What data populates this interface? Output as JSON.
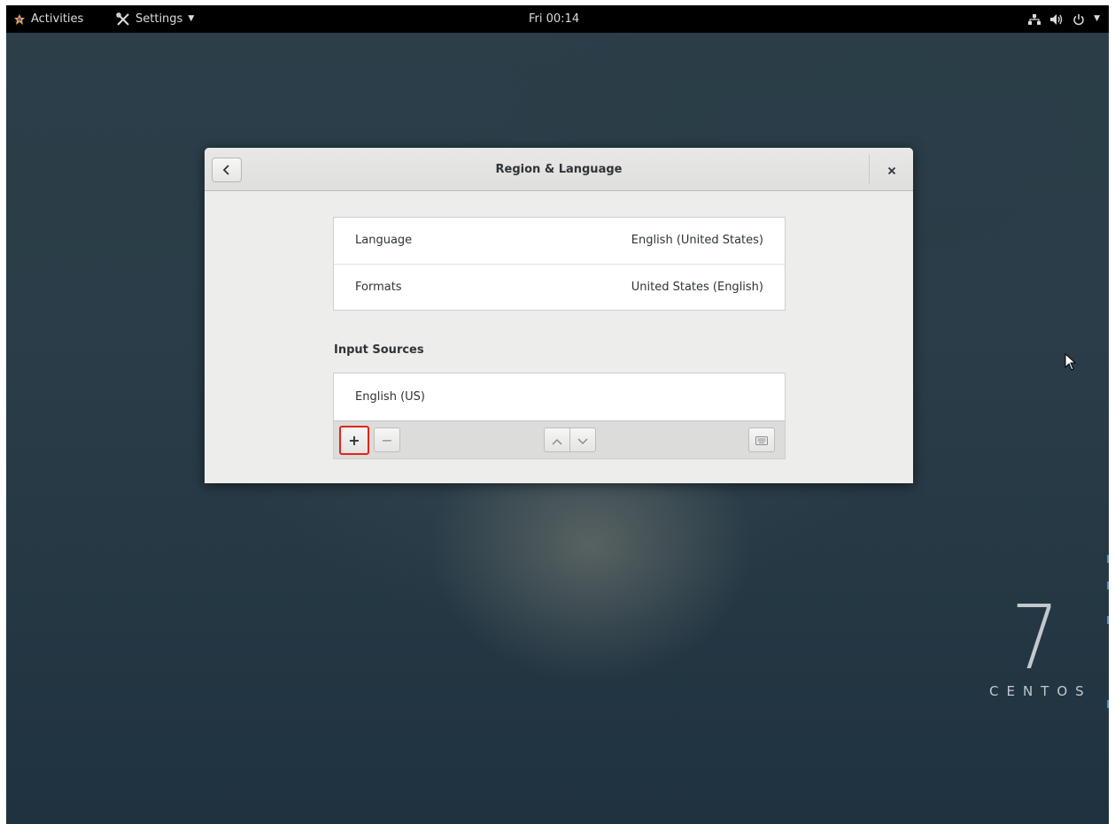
{
  "topbar": {
    "activities_label": "Activities",
    "app_menu_label": "Settings",
    "clock": "Fri 00:14"
  },
  "dialog": {
    "title": "Region & Language",
    "language_label": "Language",
    "language_value": "English (United States)",
    "formats_label": "Formats",
    "formats_value": "United States (English)",
    "input_sources_heading": "Input Sources",
    "input_sources": [
      "English (US)"
    ],
    "toolbar": {
      "add_label": "+",
      "remove_label": "−"
    }
  },
  "desktop": {
    "brand_number": "7",
    "brand_name": "CENTOS"
  },
  "colors": {
    "highlight": "#e3231d",
    "topbar": "#000000",
    "dialog_bg": "#ededeb"
  }
}
